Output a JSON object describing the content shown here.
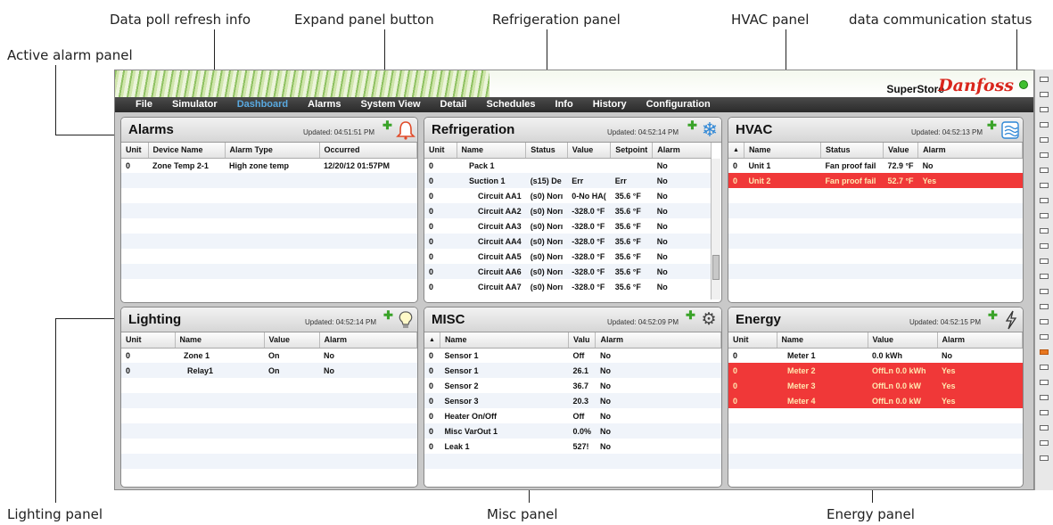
{
  "callouts": {
    "data_poll": "Data poll refresh info",
    "expand": "Expand panel button",
    "refrigeration": "Refrigeration panel",
    "hvac": "HVAC panel",
    "comm": "data communication status",
    "alarm": "Active alarm panel",
    "lighting": "Lighting panel",
    "misc": "Misc panel",
    "energy": "Energy panel"
  },
  "app": {
    "store": "SuperStore",
    "brand": "Danfoss"
  },
  "menu": [
    "File",
    "Simulator",
    "Dashboard",
    "Alarms",
    "System View",
    "Detail",
    "Schedules",
    "Info",
    "History",
    "Configuration"
  ],
  "active_menu": "Dashboard",
  "alarms": {
    "title": "Alarms",
    "updated": "Updated: 04:51:51 PM",
    "icon": "bell-icon",
    "columns": [
      "Unit",
      "Device Name",
      "Alarm Type",
      "Occurred"
    ],
    "rows": [
      [
        "0",
        "Zone Temp 2-1",
        "High zone temp",
        "12/20/12 01:57PM"
      ]
    ],
    "empty_rows": 8
  },
  "refrigeration": {
    "title": "Refrigeration",
    "updated": "Updated: 04:52:14 PM",
    "icon": "snowflake-icon",
    "columns": [
      "Unit",
      "Name",
      "Status",
      "Value",
      "Setpoint",
      "Alarm"
    ],
    "rows": [
      [
        "0",
        "Pack 1",
        "",
        "",
        "",
        "No"
      ],
      [
        "0",
        "Suction 1",
        "(s15) De",
        "Err",
        "Err",
        "No"
      ],
      [
        "0",
        "Circuit AA1",
        "(s0) Norı",
        "0-No HA(",
        "35.6 °F",
        "No"
      ],
      [
        "0",
        "Circuit AA2",
        "(s0) Norı",
        "-328.0 °F",
        "35.6 °F",
        "No"
      ],
      [
        "0",
        "Circuit AA3",
        "(s0) Norı",
        "-328.0 °F",
        "35.6 °F",
        "No"
      ],
      [
        "0",
        "Circuit AA4",
        "(s0) Norı",
        "-328.0 °F",
        "35.6 °F",
        "No"
      ],
      [
        "0",
        "Circuit AA5",
        "(s0) Norı",
        "-328.0 °F",
        "35.6 °F",
        "No"
      ],
      [
        "0",
        "Circuit AA6",
        "(s0) Norı",
        "-328.0 °F",
        "35.6 °F",
        "No"
      ],
      [
        "0",
        "Circuit AA7",
        "(s0) Norı",
        "-328.0 °F",
        "35.6 °F",
        "No"
      ]
    ]
  },
  "hvac": {
    "title": "HVAC",
    "updated": "Updated: 04:52:13 PM",
    "icon": "airflow-icon",
    "columns": [
      "Name",
      "Status",
      "Value",
      "Alarm"
    ],
    "rows": [
      {
        "unit": "0",
        "cells": [
          "Unit 1",
          "Fan proof fail",
          "72.9 °F",
          "No"
        ],
        "alarm": false
      },
      {
        "unit": "0",
        "cells": [
          "Unit 2",
          "Fan proof fail",
          "52.7 °F",
          "Yes"
        ],
        "alarm": true
      }
    ],
    "empty_rows": 7
  },
  "lighting": {
    "title": "Lighting",
    "updated": "Updated: 04:52:14 PM",
    "icon": "lightbulb-icon",
    "columns": [
      "Unit",
      "Name",
      "Value",
      "Alarm"
    ],
    "rows": [
      [
        "0",
        "Zone 1",
        "On",
        "No"
      ],
      [
        "0",
        "Relay1",
        "On",
        "No"
      ]
    ],
    "empty_rows": 7
  },
  "misc": {
    "title": "MISC",
    "updated": "Updated: 04:52:09 PM",
    "icon": "gears-icon",
    "columns": [
      "Name",
      "Valu",
      "Alarm"
    ],
    "rows": [
      [
        "0",
        "Sensor 1",
        "Off",
        "No"
      ],
      [
        "0",
        "Sensor 1",
        "26.1",
        "No"
      ],
      [
        "0",
        "Sensor 2",
        "36.7",
        "No"
      ],
      [
        "0",
        "Sensor 3",
        "20.3",
        "No"
      ],
      [
        "0",
        "Heater On/Off",
        "Off",
        "No"
      ],
      [
        "0",
        "Misc VarOut 1",
        "0.0%",
        "No"
      ],
      [
        "0",
        "Leak 1",
        "527!",
        "No"
      ]
    ],
    "empty_rows": 2
  },
  "energy": {
    "title": "Energy",
    "updated": "Updated: 04:52:15 PM",
    "icon": "lightning-icon",
    "columns": [
      "Unit",
      "Name",
      "Value",
      "Alarm"
    ],
    "rows": [
      {
        "cells": [
          "0",
          "Meter 1",
          "0.0 kWh",
          "No"
        ],
        "alarm": false
      },
      {
        "cells": [
          "0",
          "Meter 2",
          "OffLn 0.0 kWh",
          "Yes"
        ],
        "alarm": true
      },
      {
        "cells": [
          "0",
          "Meter 3",
          "OffLn 0.0 kW",
          "Yes"
        ],
        "alarm": true
      },
      {
        "cells": [
          "0",
          "Meter 4",
          "OffLn 0.0 kW",
          "Yes"
        ],
        "alarm": true
      }
    ],
    "empty_rows": 5
  }
}
